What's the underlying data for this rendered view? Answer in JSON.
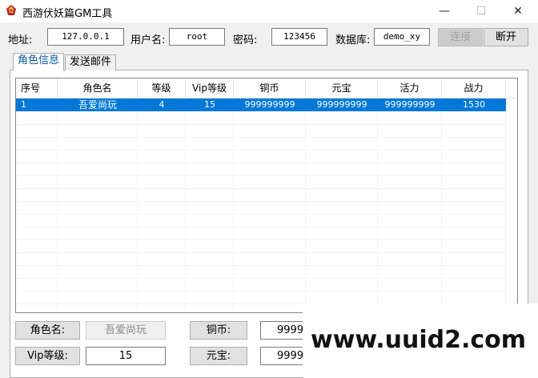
{
  "window": {
    "title": "西游伏妖篇GM工具",
    "minimize_glyph": "—",
    "maximize_glyph": "☐",
    "close_glyph": "✕"
  },
  "connection": {
    "address_label": "地址:",
    "address_value": "127.0.0.1",
    "username_label": "用户名:",
    "username_value": "root",
    "password_label": "密码:",
    "password_value": "123456",
    "database_label": "数据库:",
    "database_value": "demo_xy",
    "connect_label": "连接",
    "disconnect_label": "断开"
  },
  "tabs": [
    {
      "label": "角色信息",
      "active": true
    },
    {
      "label": "发送邮件",
      "active": false
    }
  ],
  "table": {
    "columns": [
      "序号",
      "角色名",
      "等级",
      "Vip等级",
      "铜币",
      "元宝",
      "活力",
      "战力"
    ],
    "rows": [
      [
        "1",
        "吾爱尚玩",
        "4",
        "15",
        "999999999",
        "999999999",
        "999999999",
        "1530"
      ]
    ]
  },
  "form": {
    "role_name_label": "角色名:",
    "role_name_value": "吾爱尚玩",
    "copper_label": "铜币:",
    "copper_value": "99999",
    "vip_label": "Vip等级:",
    "vip_value": "15",
    "yuanbao_label": "元宝:",
    "yuanbao_value": "99999"
  },
  "watermark": {
    "text": "www.uuid2.com"
  },
  "colors": {
    "selection": "#0078d7",
    "active_tab_text": "#0b57a8"
  }
}
